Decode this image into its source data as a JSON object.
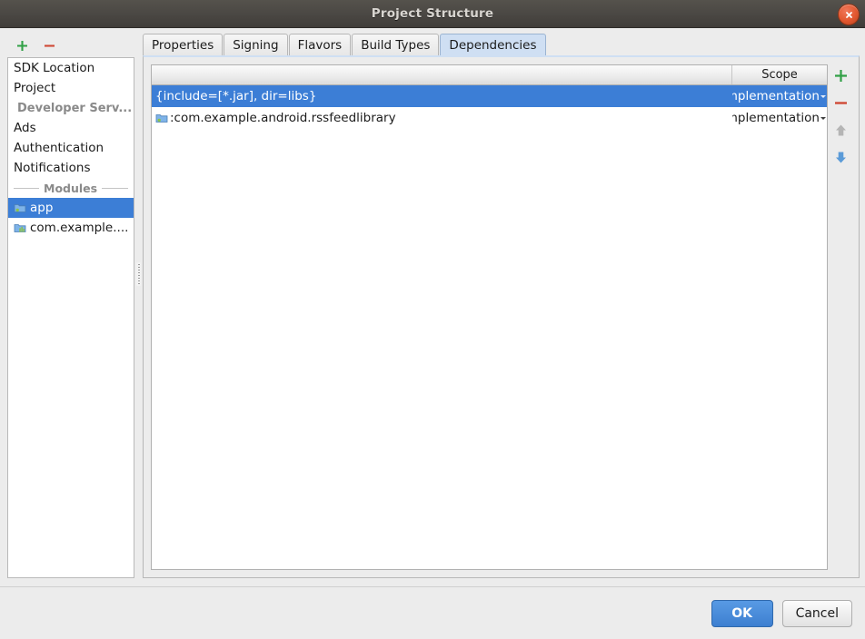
{
  "window": {
    "title": "Project Structure",
    "close_icon": "close-icon"
  },
  "left_toolbar": {
    "add_label": "+",
    "remove_label": "−"
  },
  "sidebar": {
    "items": [
      {
        "label": "SDK Location",
        "type": "item",
        "selected": false
      },
      {
        "label": "Project",
        "type": "item",
        "selected": false
      },
      {
        "label": "Developer Serv...",
        "type": "muted",
        "selected": false
      },
      {
        "label": "Ads",
        "type": "item",
        "selected": false
      },
      {
        "label": "Authentication",
        "type": "item",
        "selected": false
      },
      {
        "label": "Notifications",
        "type": "item",
        "selected": false
      }
    ],
    "separator_label": "Modules",
    "modules": [
      {
        "label": "app",
        "icon": "android-module-icon",
        "selected": true
      },
      {
        "label": "com.example....",
        "icon": "library-module-icon",
        "selected": false
      }
    ]
  },
  "tabs": [
    {
      "label": "Properties",
      "active": false
    },
    {
      "label": "Signing",
      "active": false
    },
    {
      "label": "Flavors",
      "active": false
    },
    {
      "label": "Build Types",
      "active": false
    },
    {
      "label": "Dependencies",
      "active": true
    }
  ],
  "dependencies_table": {
    "columns": [
      {
        "key": "name",
        "label": ""
      },
      {
        "key": "scope",
        "label": "Scope"
      }
    ],
    "rows": [
      {
        "name": "{include=[*.jar], dir=libs}",
        "scope": "Implementation",
        "icon": null,
        "selected": true
      },
      {
        "name": ":com.example.android.rssfeedlibrary",
        "scope": "Implementation",
        "icon": "module-dependency-icon",
        "selected": false
      }
    ]
  },
  "table_toolbar": {
    "add_label": "+",
    "remove_label": "−",
    "move_up_label": "↑",
    "move_down_label": "↓"
  },
  "footer": {
    "ok_label": "OK",
    "cancel_label": "Cancel"
  },
  "colors": {
    "selection_blue": "#3c7ed6",
    "active_tab": "#cfdff3",
    "add_green": "#31a046",
    "remove_red": "#cf4a35",
    "arrow_blue": "#5b9bd8",
    "arrow_gray": "#b5b5b5",
    "titlebar": "#4b4844",
    "close_orange": "#e2572f",
    "dialog_bg": "#ececec"
  }
}
